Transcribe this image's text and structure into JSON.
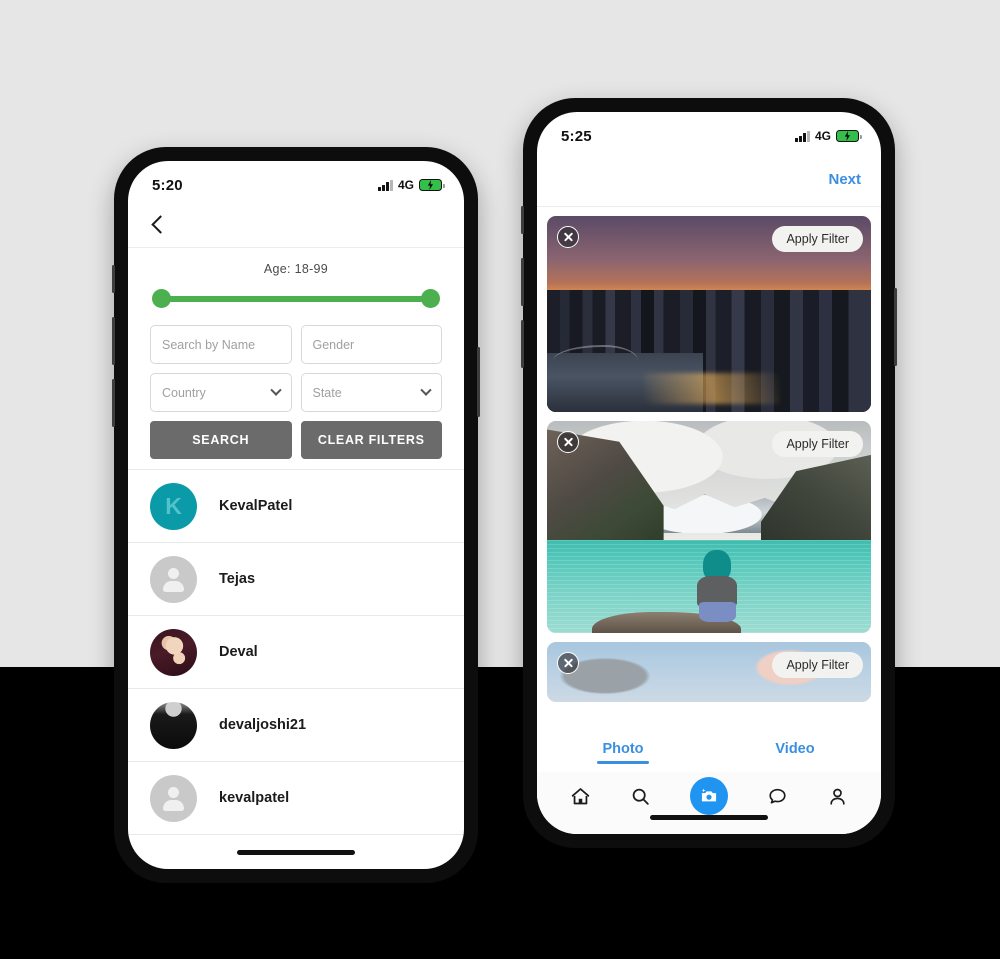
{
  "background": {
    "top_color": "#e6e6e6",
    "bottom_color": "#000000"
  },
  "left_phone": {
    "status": {
      "time": "5:20",
      "network": "4G",
      "battery_state": "charging",
      "battery_color": "#32c04a"
    },
    "navbar": {
      "back_icon": "chevron-left-icon"
    },
    "filters": {
      "age_label": "Age:  18-99",
      "slider": {
        "min": 18,
        "max": 99,
        "color": "#4caf50"
      },
      "fields": [
        {
          "name": "search-by-name",
          "placeholder": "Search by Name",
          "type": "text"
        },
        {
          "name": "gender",
          "placeholder": "Gender",
          "type": "text"
        },
        {
          "name": "country",
          "placeholder": "Country",
          "type": "select"
        },
        {
          "name": "state",
          "placeholder": "State",
          "type": "select"
        }
      ],
      "buttons": [
        {
          "name": "search-button",
          "label": "SEARCH"
        },
        {
          "name": "clear-filters-button",
          "label": "CLEAR FILTERS"
        }
      ]
    },
    "users": [
      {
        "name": "KevalPatel",
        "avatar_type": "initial",
        "initial": "K",
        "avatar_color": "#0b9aa8"
      },
      {
        "name": "Tejas",
        "avatar_type": "placeholder",
        "initial": "",
        "avatar_color": "#c9c9c9"
      },
      {
        "name": "Deval",
        "avatar_type": "photo-deval",
        "initial": "",
        "avatar_color": "#3a1420"
      },
      {
        "name": "devaljoshi21",
        "avatar_type": "photo-dj",
        "initial": "",
        "avatar_color": "#1a1a1a"
      },
      {
        "name": "kevalpatel",
        "avatar_type": "placeholder",
        "initial": "",
        "avatar_color": "#c9c9c9"
      }
    ]
  },
  "right_phone": {
    "status": {
      "time": "5:25",
      "network": "4G",
      "battery_state": "charging",
      "battery_color": "#32c04a"
    },
    "navbar": {
      "next_label": "Next",
      "next_color": "#3b8fe0"
    },
    "media": [
      {
        "id": "city-sunset",
        "close_label": "close-icon",
        "filter_label": "Apply Filter"
      },
      {
        "id": "lake-mountain",
        "close_label": "close-icon",
        "filter_label": "Apply Filter"
      },
      {
        "id": "sky-clouds",
        "close_label": "close-icon",
        "filter_label": "Apply Filter"
      }
    ],
    "segments": [
      {
        "label": "Photo",
        "active": true
      },
      {
        "label": "Video",
        "active": false
      }
    ],
    "tabbar": [
      {
        "name": "home",
        "icon": "home-icon"
      },
      {
        "name": "search",
        "icon": "search-icon"
      },
      {
        "name": "camera",
        "icon": "camera-add-icon"
      },
      {
        "name": "messages",
        "icon": "chat-bubble-icon"
      },
      {
        "name": "profile",
        "icon": "person-icon"
      }
    ],
    "accent_color": "#1f94f0"
  }
}
